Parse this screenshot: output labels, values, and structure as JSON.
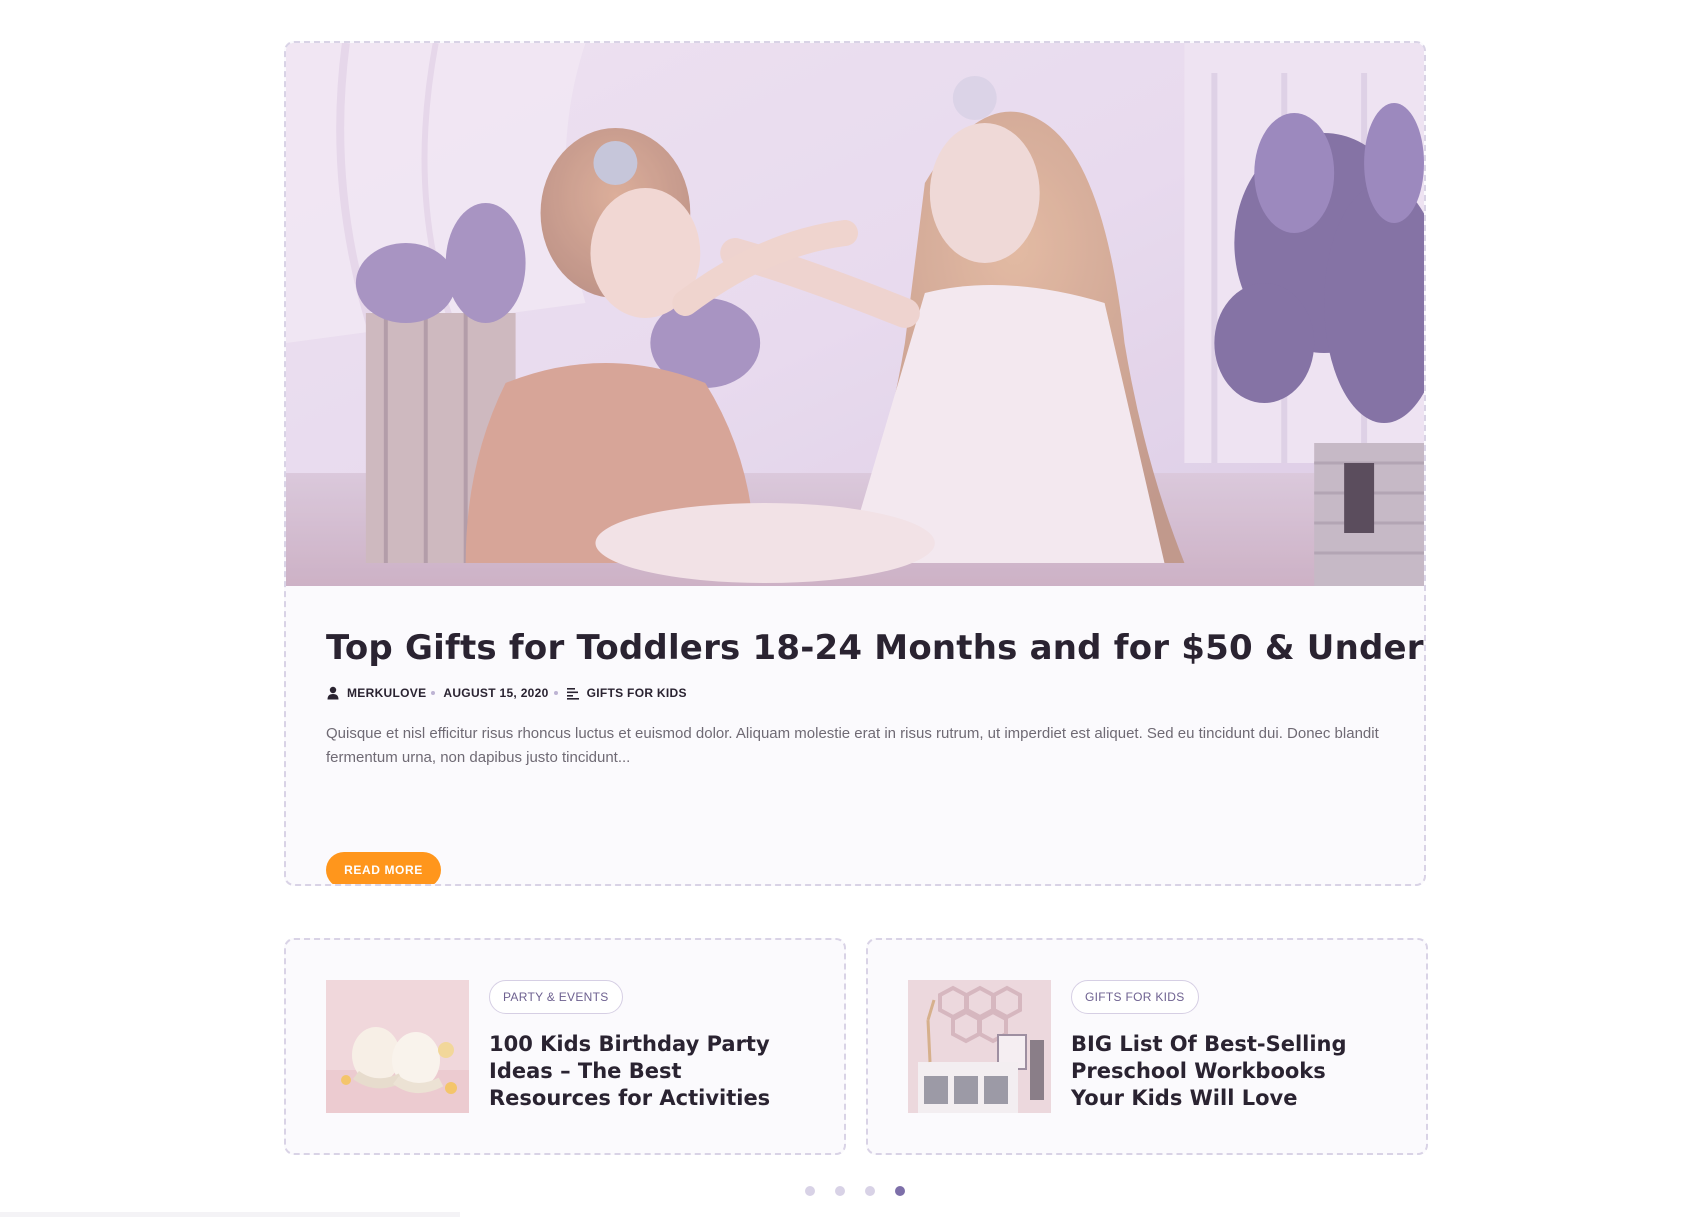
{
  "featured": {
    "title": "Top Gifts for Toddlers 18-24 Months and for $50 & Under",
    "author": "MERKULOVE",
    "date": "AUGUST 15, 2020",
    "category": "GIFTS FOR KIDS",
    "excerpt": "Quisque et nisl efficitur risus rhoncus luctus et euismod dolor. Aliquam molestie erat in risus rutrum, ut imperdiet est aliquet. Sed eu tincidunt dui. Donec blandit fermentum urna, non dapibus justo tincidunt...",
    "read_more_label": "READ MORE",
    "image_alt": "Two girls playing, one touching the other's nose"
  },
  "cards": [
    {
      "tag": "PARTY & EVENTS",
      "title": "100 Kids Birthday Party Ideas – The Best Resources for Activities",
      "image_alt": "Knitted baby booties"
    },
    {
      "tag": "GIFTS FOR KIDS",
      "title": "BIG List Of Best-Selling Preschool Workbooks Your Kids Will Love",
      "image_alt": "Hexagon shelves above a white dresser"
    }
  ],
  "carousel": {
    "dot_count": 4,
    "active_index": 3
  },
  "colors": {
    "accent_button": "#ff961c",
    "card_border": "#d9d3e6",
    "title_text": "#2a2331",
    "tag_text": "#6e6190",
    "dot_active": "#7d6fa9",
    "dot_inactive": "#d8d2e6"
  }
}
